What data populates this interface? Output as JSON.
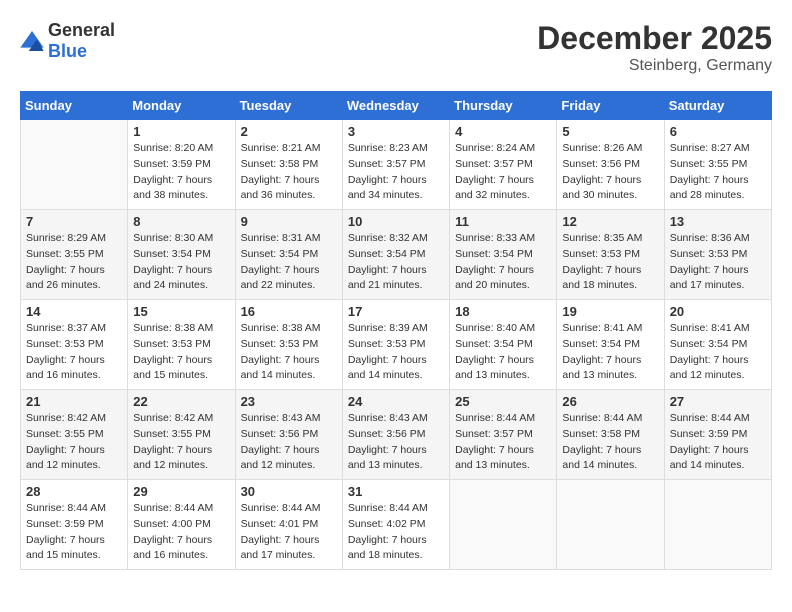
{
  "header": {
    "logo_general": "General",
    "logo_blue": "Blue",
    "month": "December 2025",
    "location": "Steinberg, Germany"
  },
  "days_of_week": [
    "Sunday",
    "Monday",
    "Tuesday",
    "Wednesday",
    "Thursday",
    "Friday",
    "Saturday"
  ],
  "weeks": [
    [
      {
        "day": "",
        "sunrise": "",
        "sunset": "",
        "daylight": ""
      },
      {
        "day": "1",
        "sunrise": "Sunrise: 8:20 AM",
        "sunset": "Sunset: 3:59 PM",
        "daylight": "Daylight: 7 hours and 38 minutes."
      },
      {
        "day": "2",
        "sunrise": "Sunrise: 8:21 AM",
        "sunset": "Sunset: 3:58 PM",
        "daylight": "Daylight: 7 hours and 36 minutes."
      },
      {
        "day": "3",
        "sunrise": "Sunrise: 8:23 AM",
        "sunset": "Sunset: 3:57 PM",
        "daylight": "Daylight: 7 hours and 34 minutes."
      },
      {
        "day": "4",
        "sunrise": "Sunrise: 8:24 AM",
        "sunset": "Sunset: 3:57 PM",
        "daylight": "Daylight: 7 hours and 32 minutes."
      },
      {
        "day": "5",
        "sunrise": "Sunrise: 8:26 AM",
        "sunset": "Sunset: 3:56 PM",
        "daylight": "Daylight: 7 hours and 30 minutes."
      },
      {
        "day": "6",
        "sunrise": "Sunrise: 8:27 AM",
        "sunset": "Sunset: 3:55 PM",
        "daylight": "Daylight: 7 hours and 28 minutes."
      }
    ],
    [
      {
        "day": "7",
        "sunrise": "Sunrise: 8:29 AM",
        "sunset": "Sunset: 3:55 PM",
        "daylight": "Daylight: 7 hours and 26 minutes."
      },
      {
        "day": "8",
        "sunrise": "Sunrise: 8:30 AM",
        "sunset": "Sunset: 3:54 PM",
        "daylight": "Daylight: 7 hours and 24 minutes."
      },
      {
        "day": "9",
        "sunrise": "Sunrise: 8:31 AM",
        "sunset": "Sunset: 3:54 PM",
        "daylight": "Daylight: 7 hours and 22 minutes."
      },
      {
        "day": "10",
        "sunrise": "Sunrise: 8:32 AM",
        "sunset": "Sunset: 3:54 PM",
        "daylight": "Daylight: 7 hours and 21 minutes."
      },
      {
        "day": "11",
        "sunrise": "Sunrise: 8:33 AM",
        "sunset": "Sunset: 3:54 PM",
        "daylight": "Daylight: 7 hours and 20 minutes."
      },
      {
        "day": "12",
        "sunrise": "Sunrise: 8:35 AM",
        "sunset": "Sunset: 3:53 PM",
        "daylight": "Daylight: 7 hours and 18 minutes."
      },
      {
        "day": "13",
        "sunrise": "Sunrise: 8:36 AM",
        "sunset": "Sunset: 3:53 PM",
        "daylight": "Daylight: 7 hours and 17 minutes."
      }
    ],
    [
      {
        "day": "14",
        "sunrise": "Sunrise: 8:37 AM",
        "sunset": "Sunset: 3:53 PM",
        "daylight": "Daylight: 7 hours and 16 minutes."
      },
      {
        "day": "15",
        "sunrise": "Sunrise: 8:38 AM",
        "sunset": "Sunset: 3:53 PM",
        "daylight": "Daylight: 7 hours and 15 minutes."
      },
      {
        "day": "16",
        "sunrise": "Sunrise: 8:38 AM",
        "sunset": "Sunset: 3:53 PM",
        "daylight": "Daylight: 7 hours and 14 minutes."
      },
      {
        "day": "17",
        "sunrise": "Sunrise: 8:39 AM",
        "sunset": "Sunset: 3:53 PM",
        "daylight": "Daylight: 7 hours and 14 minutes."
      },
      {
        "day": "18",
        "sunrise": "Sunrise: 8:40 AM",
        "sunset": "Sunset: 3:54 PM",
        "daylight": "Daylight: 7 hours and 13 minutes."
      },
      {
        "day": "19",
        "sunrise": "Sunrise: 8:41 AM",
        "sunset": "Sunset: 3:54 PM",
        "daylight": "Daylight: 7 hours and 13 minutes."
      },
      {
        "day": "20",
        "sunrise": "Sunrise: 8:41 AM",
        "sunset": "Sunset: 3:54 PM",
        "daylight": "Daylight: 7 hours and 12 minutes."
      }
    ],
    [
      {
        "day": "21",
        "sunrise": "Sunrise: 8:42 AM",
        "sunset": "Sunset: 3:55 PM",
        "daylight": "Daylight: 7 hours and 12 minutes."
      },
      {
        "day": "22",
        "sunrise": "Sunrise: 8:42 AM",
        "sunset": "Sunset: 3:55 PM",
        "daylight": "Daylight: 7 hours and 12 minutes."
      },
      {
        "day": "23",
        "sunrise": "Sunrise: 8:43 AM",
        "sunset": "Sunset: 3:56 PM",
        "daylight": "Daylight: 7 hours and 12 minutes."
      },
      {
        "day": "24",
        "sunrise": "Sunrise: 8:43 AM",
        "sunset": "Sunset: 3:56 PM",
        "daylight": "Daylight: 7 hours and 13 minutes."
      },
      {
        "day": "25",
        "sunrise": "Sunrise: 8:44 AM",
        "sunset": "Sunset: 3:57 PM",
        "daylight": "Daylight: 7 hours and 13 minutes."
      },
      {
        "day": "26",
        "sunrise": "Sunrise: 8:44 AM",
        "sunset": "Sunset: 3:58 PM",
        "daylight": "Daylight: 7 hours and 14 minutes."
      },
      {
        "day": "27",
        "sunrise": "Sunrise: 8:44 AM",
        "sunset": "Sunset: 3:59 PM",
        "daylight": "Daylight: 7 hours and 14 minutes."
      }
    ],
    [
      {
        "day": "28",
        "sunrise": "Sunrise: 8:44 AM",
        "sunset": "Sunset: 3:59 PM",
        "daylight": "Daylight: 7 hours and 15 minutes."
      },
      {
        "day": "29",
        "sunrise": "Sunrise: 8:44 AM",
        "sunset": "Sunset: 4:00 PM",
        "daylight": "Daylight: 7 hours and 16 minutes."
      },
      {
        "day": "30",
        "sunrise": "Sunrise: 8:44 AM",
        "sunset": "Sunset: 4:01 PM",
        "daylight": "Daylight: 7 hours and 17 minutes."
      },
      {
        "day": "31",
        "sunrise": "Sunrise: 8:44 AM",
        "sunset": "Sunset: 4:02 PM",
        "daylight": "Daylight: 7 hours and 18 minutes."
      },
      {
        "day": "",
        "sunrise": "",
        "sunset": "",
        "daylight": ""
      },
      {
        "day": "",
        "sunrise": "",
        "sunset": "",
        "daylight": ""
      },
      {
        "day": "",
        "sunrise": "",
        "sunset": "",
        "daylight": ""
      }
    ]
  ]
}
